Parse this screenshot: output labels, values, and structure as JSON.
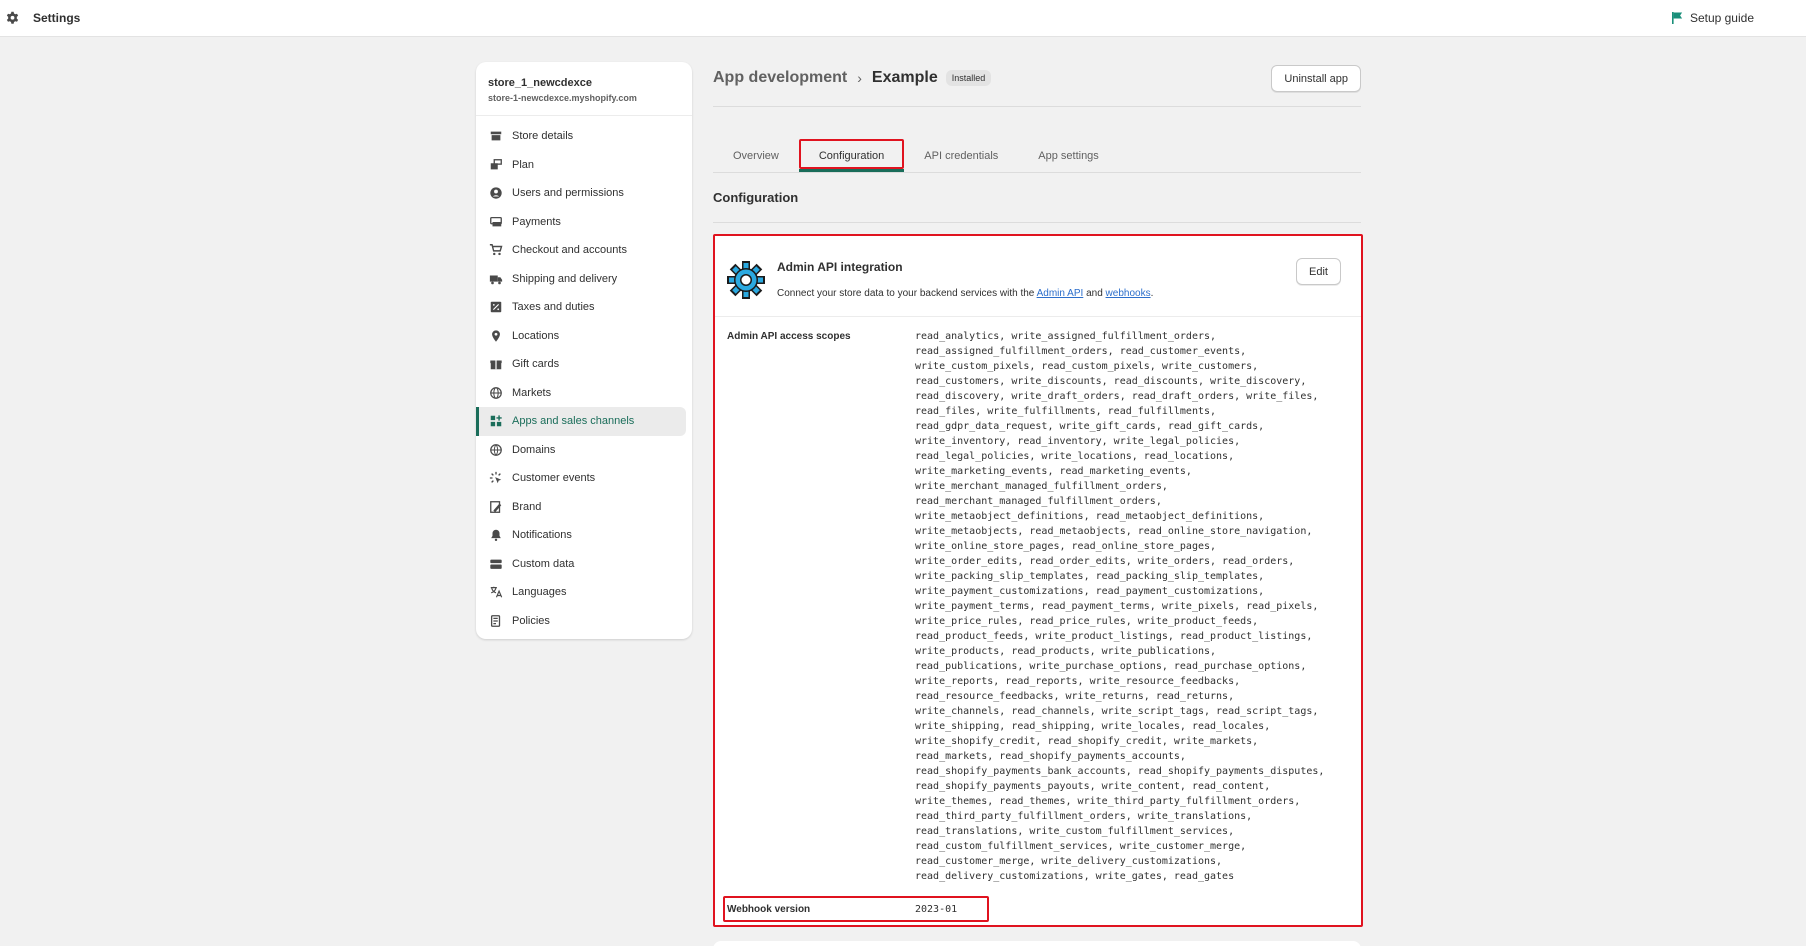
{
  "topbar": {
    "title": "Settings",
    "setup_guide": "Setup guide"
  },
  "store": {
    "name": "store_1_newcdexce",
    "domain": "store-1-newcdexce.myshopify.com"
  },
  "nav": [
    {
      "label": "Store details",
      "icon": "store-icon"
    },
    {
      "label": "Plan",
      "icon": "plan-icon"
    },
    {
      "label": "Users and permissions",
      "icon": "user-icon"
    },
    {
      "label": "Payments",
      "icon": "payments-icon"
    },
    {
      "label": "Checkout and accounts",
      "icon": "cart-icon"
    },
    {
      "label": "Shipping and delivery",
      "icon": "truck-icon"
    },
    {
      "label": "Taxes and duties",
      "icon": "tax-icon"
    },
    {
      "label": "Locations",
      "icon": "location-icon"
    },
    {
      "label": "Gift cards",
      "icon": "gift-icon"
    },
    {
      "label": "Markets",
      "icon": "globe-icon"
    },
    {
      "label": "Apps and sales channels",
      "icon": "apps-icon"
    },
    {
      "label": "Domains",
      "icon": "domains-icon"
    },
    {
      "label": "Customer events",
      "icon": "events-icon"
    },
    {
      "label": "Brand",
      "icon": "brand-icon"
    },
    {
      "label": "Notifications",
      "icon": "bell-icon"
    },
    {
      "label": "Custom data",
      "icon": "custom-data-icon"
    },
    {
      "label": "Languages",
      "icon": "language-icon"
    },
    {
      "label": "Policies",
      "icon": "policies-icon"
    }
  ],
  "active_nav": "Apps and sales channels",
  "breadcrumb": {
    "parent": "App development",
    "separator": "›",
    "current": "Example",
    "badge": "Installed"
  },
  "uninstall_label": "Uninstall app",
  "tabs": [
    {
      "label": "Overview"
    },
    {
      "label": "Configuration"
    },
    {
      "label": "API credentials"
    },
    {
      "label": "App settings"
    }
  ],
  "active_tab": "Configuration",
  "section_title": "Configuration",
  "card": {
    "title": "Admin API integration",
    "desc_prefix": "Connect your store data to your backend services with the ",
    "link_admin_api": "Admin API",
    "desc_and": " and ",
    "link_webhooks": "webhooks",
    "desc_suffix": ".",
    "edit_label": "Edit",
    "scopes_label": "Admin API access scopes",
    "scopes_lines": [
      "read_analytics, write_assigned_fulfillment_orders,",
      "read_assigned_fulfillment_orders, read_customer_events,",
      "write_custom_pixels, read_custom_pixels, write_customers,",
      "read_customers, write_discounts, read_discounts, write_discovery,",
      "read_discovery, write_draft_orders, read_draft_orders, write_files,",
      "read_files, write_fulfillments, read_fulfillments,",
      "read_gdpr_data_request, write_gift_cards, read_gift_cards,",
      "write_inventory, read_inventory, write_legal_policies,",
      "read_legal_policies, write_locations, read_locations,",
      "write_marketing_events, read_marketing_events,",
      "write_merchant_managed_fulfillment_orders,",
      "read_merchant_managed_fulfillment_orders,",
      "write_metaobject_definitions, read_metaobject_definitions,",
      "write_metaobjects, read_metaobjects, read_online_store_navigation,",
      "write_online_store_pages, read_online_store_pages,",
      "write_order_edits, read_order_edits, write_orders, read_orders,",
      "write_packing_slip_templates, read_packing_slip_templates,",
      "write_payment_customizations, read_payment_customizations,",
      "write_payment_terms, read_payment_terms, write_pixels, read_pixels,",
      "write_price_rules, read_price_rules, write_product_feeds,",
      "read_product_feeds, write_product_listings, read_product_listings,",
      "write_products, read_products, write_publications,",
      "read_publications, write_purchase_options, read_purchase_options,",
      "write_reports, read_reports, write_resource_feedbacks,",
      "read_resource_feedbacks, write_returns, read_returns,",
      "write_channels, read_channels, write_script_tags, read_script_tags,",
      "write_shipping, read_shipping, write_locales, read_locales,",
      "write_shopify_credit, read_shopify_credit, write_markets,",
      "read_markets, read_shopify_payments_accounts,",
      "read_shopify_payments_bank_accounts, read_shopify_payments_disputes,",
      "read_shopify_payments_payouts, write_content, read_content,",
      "write_themes, read_themes, write_third_party_fulfillment_orders,",
      "read_third_party_fulfillment_orders, write_translations,",
      "read_translations, write_custom_fulfillment_services,",
      "read_custom_fulfillment_services, write_customer_merge,",
      "read_customer_merge, write_delivery_customizations,",
      "read_delivery_customizations, write_gates, read_gates"
    ],
    "webhook_label": "Webhook version",
    "webhook_value": "2023-01"
  },
  "colors": {
    "accent": "#1a6d5a",
    "highlight": "#e0131f",
    "link": "#2c6ecb"
  }
}
